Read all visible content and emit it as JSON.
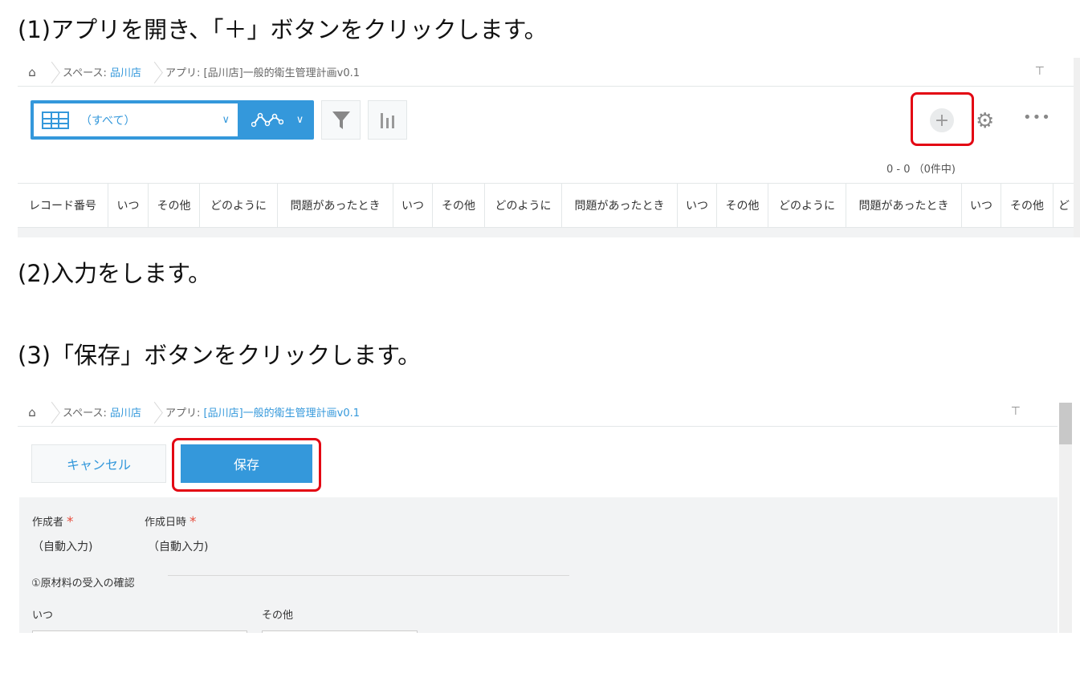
{
  "steps": {
    "step1": "(1)アプリを開き、「＋」ボタンをクリックします。",
    "step2": "(2)入力をします。",
    "step3": "(3)「保存」ボタンをクリックします。"
  },
  "breadcrumb": {
    "space_prefix": "スペース:",
    "space_name": "品川店",
    "app_prefix": "アプリ:",
    "app_name": "[品川店]一般的衛生管理計画v0.1"
  },
  "list_view": {
    "view_selector_label": "（すべて）",
    "record_count": "0 - 0 （0件中)",
    "columns": [
      "レコード番号",
      "いつ",
      "その他",
      "どのように",
      "問題があったとき",
      "いつ",
      "その他",
      "どのように",
      "問題があったとき",
      "いつ",
      "その他",
      "どのように",
      "問題があったとき",
      "いつ",
      "その他",
      "ど"
    ]
  },
  "edit_view": {
    "cancel_label": "キャンセル",
    "save_label": "保存",
    "fields": {
      "creator_label": "作成者",
      "creator_value": "（自動入力)",
      "created_at_label": "作成日時",
      "created_at_value": "（自動入力)",
      "required_mark": "*",
      "group_label": "①原材料の受入の確認",
      "when_label": "いつ",
      "other_label": "その他"
    }
  },
  "icons": {
    "home": "home-icon",
    "pin": "pin-icon",
    "table": "table-view-icon",
    "graph": "graph-icon",
    "filter": "filter-icon",
    "chart": "bar-chart-icon",
    "plus": "plus-icon",
    "gear": "gear-icon",
    "more": "more-dots-icon"
  },
  "colors": {
    "accent": "#3498db",
    "highlight": "#e30613",
    "required": "#e74c3c"
  }
}
